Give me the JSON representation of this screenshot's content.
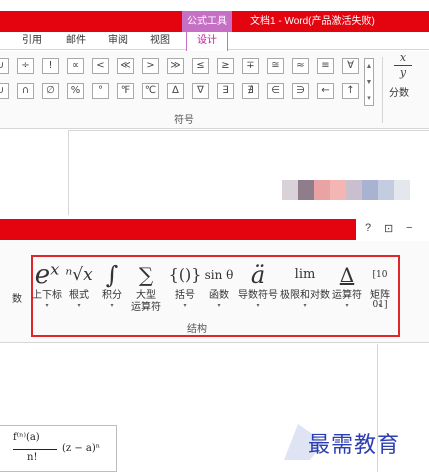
{
  "title_bar": {
    "context_tab": "公式工具",
    "window_title": "文档1 - Word(产品激活失败)"
  },
  "tabs": [
    {
      "label": "引用"
    },
    {
      "label": "邮件"
    },
    {
      "label": "审阅"
    },
    {
      "label": "视图"
    },
    {
      "label": "设计",
      "active": true
    }
  ],
  "symbols": {
    "row1": [
      "∪",
      "÷",
      "!",
      "∝",
      "<",
      "≪",
      ">",
      "≫",
      "≤",
      "≥",
      "∓",
      "≅",
      "≈",
      "≡",
      "∀"
    ],
    "row2": [
      "∪",
      "∩",
      "∅",
      "%",
      "°",
      "℉",
      "℃",
      "∆",
      "∇",
      "∃",
      "∄",
      "∈",
      "∋",
      "←",
      "↑"
    ],
    "group_label": "符号"
  },
  "fraction": {
    "numerator": "x",
    "denominator": "y",
    "label": "分数"
  },
  "window_controls": {
    "help": "?",
    "restore": "⊡",
    "minimize": "−"
  },
  "structures": {
    "cut_label": "数",
    "items": [
      {
        "icon": "eˣ",
        "label": "上下标"
      },
      {
        "icon": "ⁿ√x",
        "label": "根式"
      },
      {
        "icon": "∫",
        "label": "积分"
      },
      {
        "icon": "∑",
        "label": "大型",
        "label2": "运算符"
      },
      {
        "icon": "{()}",
        "label": "括号"
      },
      {
        "icon": "sin θ",
        "label": "函数"
      },
      {
        "icon": "ä",
        "label": "导数符号"
      },
      {
        "icon": "lim",
        "label": "极限和对数"
      },
      {
        "icon": "Δ",
        "label": "运算符"
      },
      {
        "icon": "[10 01]",
        "label": "矩阵"
      }
    ],
    "group_label": "结构"
  },
  "formula": {
    "numerator": "f⁽ⁿ⁾(a)",
    "denominator": "n!",
    "rest": "(z − a)ⁿ"
  },
  "watermark": {
    "text": "最需教育"
  },
  "colors": {
    "accent_red": "#e3040f",
    "context_purple": "#c56fc5",
    "highlight_box": "#e0262c",
    "watermark_blue": "#2d3fb0"
  }
}
